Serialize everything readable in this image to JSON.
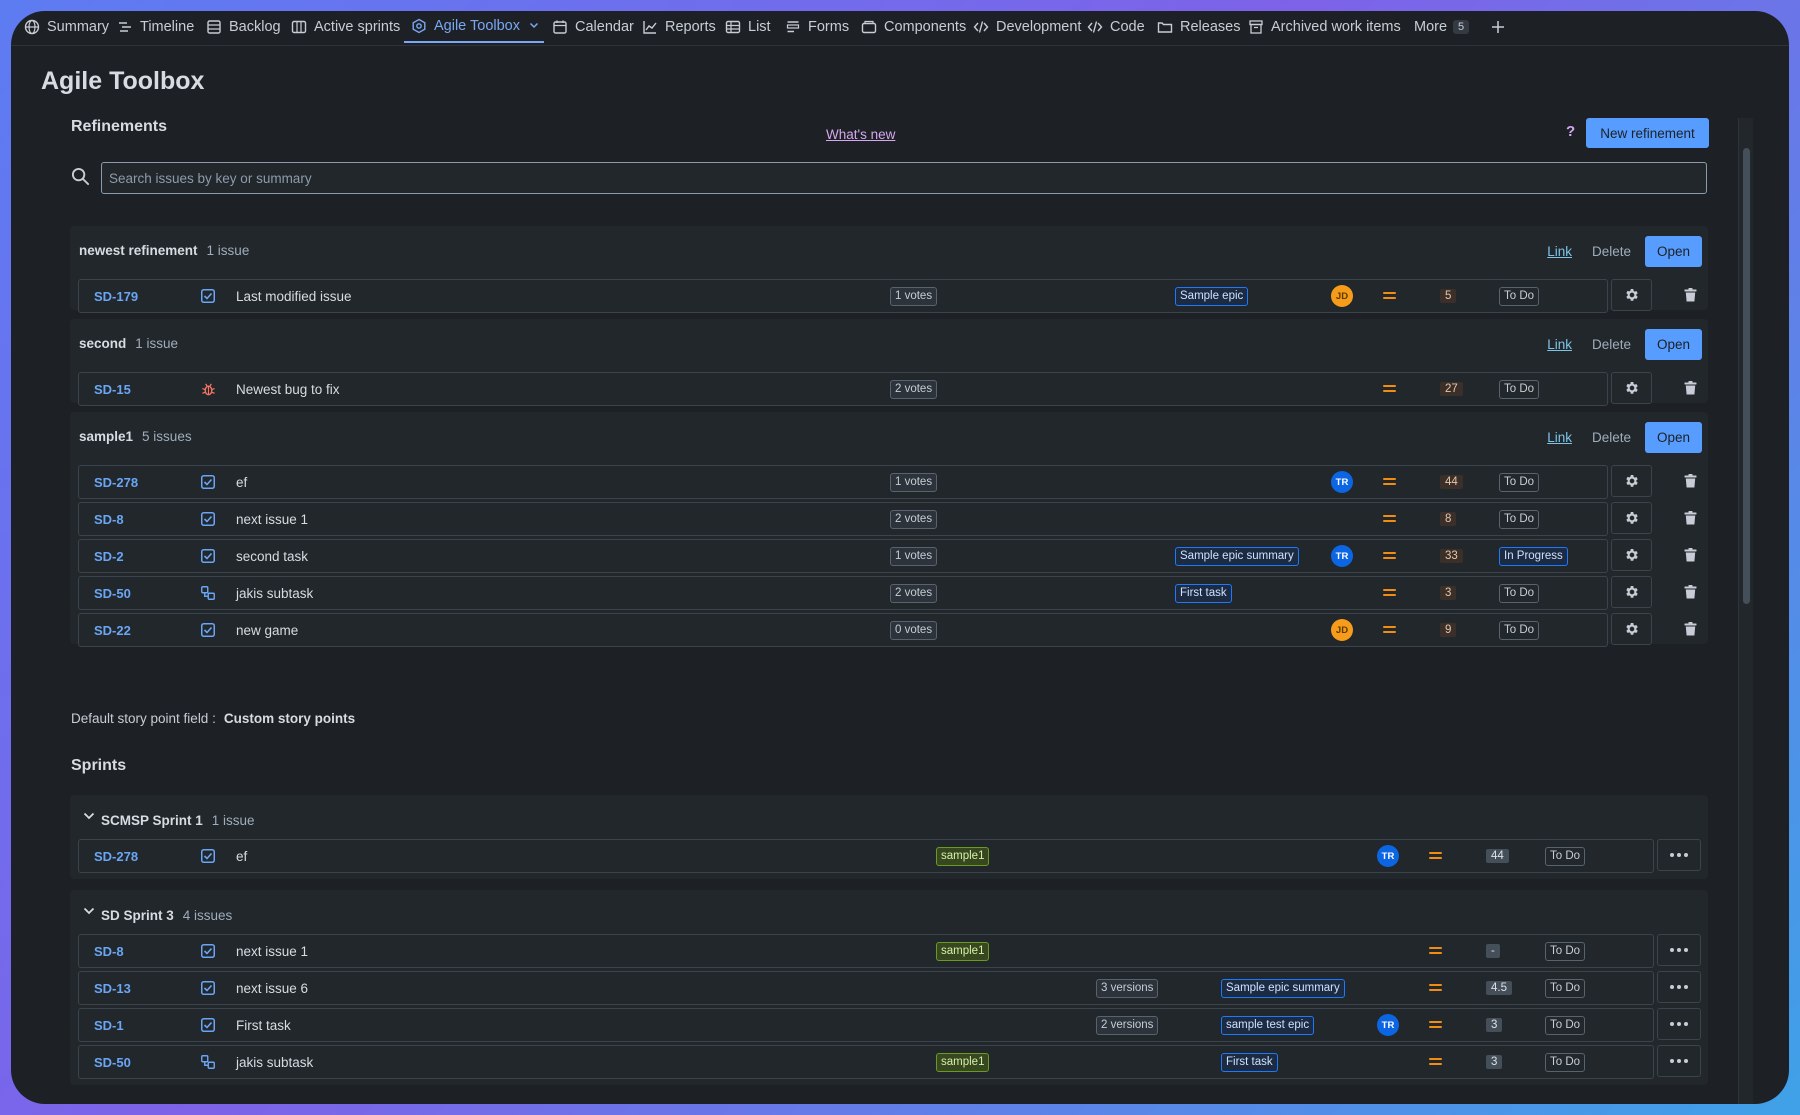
{
  "nav": {
    "items": [
      {
        "label": "Summary",
        "icon": "globe-icon"
      },
      {
        "label": "Timeline",
        "icon": "timeline-icon"
      },
      {
        "label": "Backlog",
        "icon": "backlog-icon"
      },
      {
        "label": "Active sprints",
        "icon": "board-icon"
      },
      {
        "label": "Agile Toolbox",
        "icon": "toolbox-icon",
        "active": true
      },
      {
        "label": "Calendar",
        "icon": "calendar-icon"
      },
      {
        "label": "Reports",
        "icon": "chart-icon"
      },
      {
        "label": "List",
        "icon": "list-icon"
      },
      {
        "label": "Forms",
        "icon": "forms-icon"
      },
      {
        "label": "Components",
        "icon": "components-icon"
      },
      {
        "label": "Development",
        "icon": "development-icon"
      },
      {
        "label": "Code",
        "icon": "code-icon"
      },
      {
        "label": "Releases",
        "icon": "releases-icon"
      },
      {
        "label": "Archived work items",
        "icon": "archive-icon"
      }
    ],
    "more_label": "More",
    "more_count": "5"
  },
  "page": {
    "title": "Agile Toolbox"
  },
  "refinements": {
    "title": "Refinements",
    "whats_new": "What's new",
    "help": "?",
    "new_button": "New refinement",
    "search_placeholder": "Search issues by key or summary",
    "link_label": "Link",
    "delete_label": "Delete",
    "open_label": "Open",
    "groups": [
      {
        "name": "newest refinement",
        "count": "1 issue",
        "rows": [
          {
            "key": "SD-179",
            "type": "task",
            "summary": "Last modified issue",
            "votes": "1 votes",
            "epic": "Sample epic",
            "assignee": "JD",
            "points": "5",
            "status": "To Do"
          }
        ]
      },
      {
        "name": "second",
        "count": "1 issue",
        "rows": [
          {
            "key": "SD-15",
            "type": "bug",
            "summary": "Newest bug to fix",
            "votes": "2 votes",
            "epic": "",
            "assignee": "",
            "points": "27",
            "status": "To Do"
          }
        ]
      },
      {
        "name": "sample1",
        "count": "5 issues",
        "rows": [
          {
            "key": "SD-278",
            "type": "task",
            "summary": "ef",
            "votes": "1 votes",
            "epic": "",
            "assignee": "TR",
            "points": "44",
            "status": "To Do"
          },
          {
            "key": "SD-8",
            "type": "task",
            "summary": "next issue 1",
            "votes": "2 votes",
            "epic": "",
            "assignee": "",
            "points": "8",
            "status": "To Do"
          },
          {
            "key": "SD-2",
            "type": "task",
            "summary": "second task",
            "votes": "1 votes",
            "epic": "Sample epic summary",
            "assignee": "TR",
            "points": "33",
            "status": "In Progress"
          },
          {
            "key": "SD-50",
            "type": "subtask",
            "summary": "jakis subtask",
            "votes": "2 votes",
            "epic": "First task",
            "assignee": "",
            "points": "3",
            "status": "To Do"
          },
          {
            "key": "SD-22",
            "type": "task",
            "summary": "new game",
            "votes": "0 votes",
            "epic": "",
            "assignee": "JD",
            "points": "9",
            "status": "To Do"
          }
        ]
      }
    ]
  },
  "default_field": {
    "label": "Default story point field :",
    "value": "Custom story points"
  },
  "sprints": {
    "title": "Sprints",
    "groups": [
      {
        "name": "SCMSP Sprint 1",
        "count": "1 issue",
        "rows": [
          {
            "key": "SD-278",
            "type": "task",
            "summary": "ef",
            "refinement": "sample1",
            "versions": "",
            "epic": "",
            "assignee": "TR",
            "points": "44",
            "status": "To Do"
          }
        ]
      },
      {
        "name": "SD Sprint 3",
        "count": "4 issues",
        "rows": [
          {
            "key": "SD-8",
            "type": "task",
            "summary": "next issue 1",
            "refinement": "sample1",
            "versions": "",
            "epic": "",
            "assignee": "",
            "points": "-",
            "status": "To Do"
          },
          {
            "key": "SD-13",
            "type": "task",
            "summary": "next issue 6",
            "refinement": "",
            "versions": "3 versions",
            "epic": "Sample epic summary",
            "assignee": "",
            "points": "4.5",
            "status": "To Do"
          },
          {
            "key": "SD-1",
            "type": "task",
            "summary": "First task",
            "refinement": "",
            "versions": "2 versions",
            "epic": "sample test epic",
            "assignee": "TR",
            "points": "3",
            "status": "To Do"
          },
          {
            "key": "SD-50",
            "type": "subtask",
            "summary": "jakis subtask",
            "refinement": "sample1",
            "versions": "",
            "epic": "First task",
            "assignee": "",
            "points": "3",
            "status": "To Do"
          }
        ]
      }
    ]
  },
  "colors": {
    "accent": "#579dff",
    "background": "#1d2125",
    "surface": "#22272b",
    "priority": "#f18d13"
  }
}
